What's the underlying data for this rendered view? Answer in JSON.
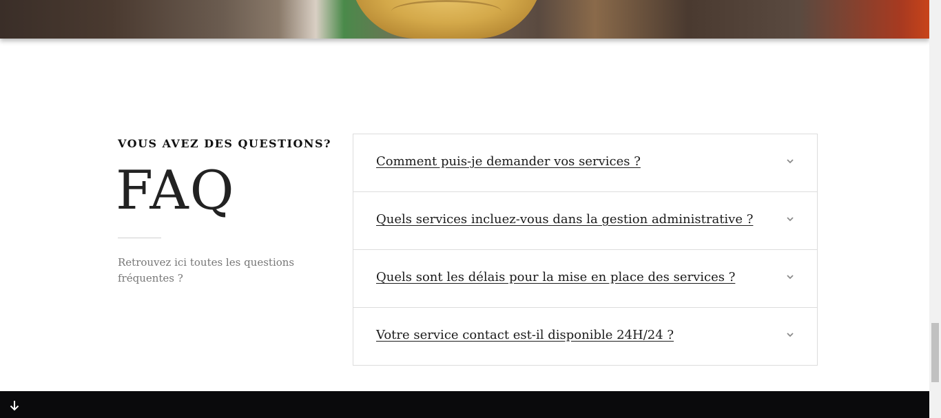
{
  "faq": {
    "kicker": "VOUS AVEZ DES QUESTIONS?",
    "title": "FAQ",
    "intro": "Retrouvez ici toutes les questions fréquentes ?",
    "items": [
      {
        "question": "Comment puis-je demander vos services ?",
        "icon": "chevron-down-icon"
      },
      {
        "question": "Quels services incluez-vous dans la gestion administrative ?",
        "icon": "chevron-down-icon"
      },
      {
        "question": "Quels sont les délais pour la mise en place des services ?",
        "icon": "chevron-down-icon"
      },
      {
        "question": "Votre service contact est-il disponible 24H/24 ?",
        "icon": "chevron-down-icon"
      }
    ]
  },
  "footer": {
    "scroll_icon": "arrow-down-icon"
  },
  "colors": {
    "footer_bg": "#0a0a0c",
    "text_dark": "#1a1a1a",
    "text_muted": "#777777",
    "border": "#dcdcdc"
  }
}
